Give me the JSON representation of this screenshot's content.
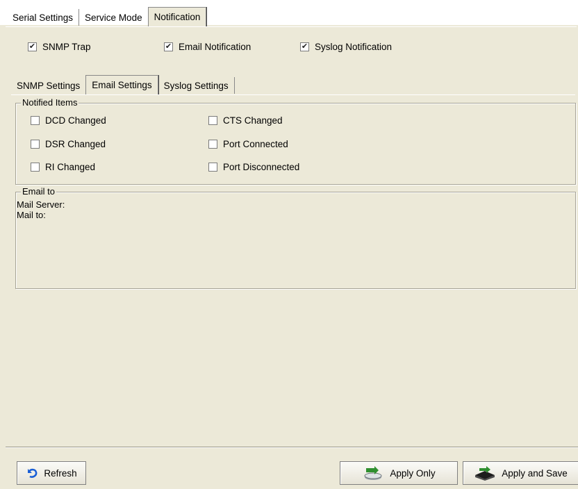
{
  "main_tabs": [
    {
      "label": "Serial Settings",
      "active": false
    },
    {
      "label": "Service Mode",
      "active": false
    },
    {
      "label": "Notification",
      "active": true
    }
  ],
  "notification_types": {
    "snmp_trap": {
      "label": "SNMP Trap",
      "checked": true
    },
    "email": {
      "label": "Email Notification",
      "checked": true
    },
    "syslog": {
      "label": "Syslog Notification",
      "checked": true
    }
  },
  "sub_tabs": [
    {
      "label": "SNMP Settings",
      "active": false
    },
    {
      "label": "Email Settings",
      "active": true
    },
    {
      "label": "Syslog Settings",
      "active": false
    }
  ],
  "notified_items": {
    "legend": "Notified Items",
    "left": [
      {
        "label": "DCD Changed",
        "checked": false
      },
      {
        "label": "DSR Changed",
        "checked": false
      },
      {
        "label": "RI Changed",
        "checked": false
      }
    ],
    "right": [
      {
        "label": "CTS Changed",
        "checked": false
      },
      {
        "label": "Port Connected",
        "checked": false
      },
      {
        "label": "Port Disconnected",
        "checked": false
      }
    ]
  },
  "email_to": {
    "legend": "Email to",
    "mail_server_label": "Mail Server:",
    "mail_to_label": "Mail to:"
  },
  "buttons": {
    "refresh": "Refresh",
    "apply_only": "Apply Only",
    "apply_save": "Apply and Save"
  },
  "colors": {
    "refresh_icon": "#1a5fd6",
    "apply_icon": "#2f8f2f"
  }
}
